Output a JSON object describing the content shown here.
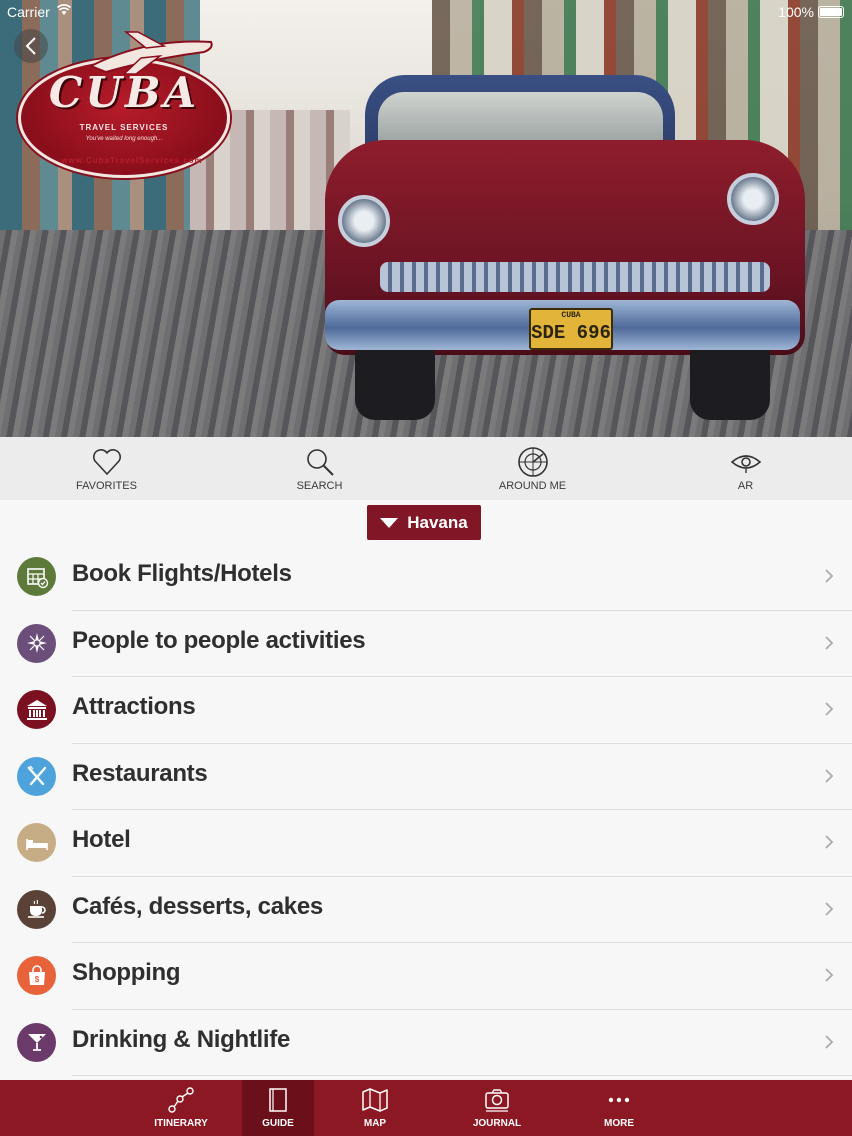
{
  "status_bar": {
    "carrier": "Carrier",
    "battery": "100%"
  },
  "logo": {
    "word": "CUBA",
    "subtitle": "TRAVEL SERVICES",
    "tagline": "You've waited long enough...",
    "url": "www.CubaTravelServices.com",
    "registered": "®"
  },
  "hero": {
    "plate_top": "CUBA",
    "plate": "SDE 696"
  },
  "toolbar": {
    "items": [
      {
        "label": "FAVORITES",
        "icon": "heart-icon"
      },
      {
        "label": "SEARCH",
        "icon": "search-icon"
      },
      {
        "label": "AROUND ME",
        "icon": "radar-icon"
      },
      {
        "label": "AR",
        "icon": "eye-icon"
      }
    ]
  },
  "city_selector": {
    "label": "Havana"
  },
  "list": {
    "items": [
      {
        "label": "Book Flights/Hotels",
        "icon": "booking-icon",
        "color": "#5d7a3a"
      },
      {
        "label": "People to people activities",
        "icon": "compass-icon",
        "color": "#6b4f7a"
      },
      {
        "label": "Attractions",
        "icon": "museum-icon",
        "color": "#7a1020"
      },
      {
        "label": "Restaurants",
        "icon": "cutlery-icon",
        "color": "#4ea3dd"
      },
      {
        "label": "Hotel",
        "icon": "bed-icon",
        "color": "#c6ad85"
      },
      {
        "label": "Cafés, desserts, cakes",
        "icon": "coffee-cup-icon",
        "color": "#5a4336"
      },
      {
        "label": "Shopping",
        "icon": "shopping-bag-icon",
        "color": "#e8623a"
      },
      {
        "label": "Drinking & Nightlife",
        "icon": "cocktail-icon",
        "color": "#6b3a6b"
      }
    ]
  },
  "tabbar": {
    "tabs": [
      {
        "label": "ITINERARY",
        "icon": "itinerary-icon",
        "active": false
      },
      {
        "label": "GUIDE",
        "icon": "book-icon",
        "active": true
      },
      {
        "label": "MAP",
        "icon": "map-icon",
        "active": false
      },
      {
        "label": "JOURNAL",
        "icon": "camera-icon",
        "active": false
      },
      {
        "label": "MORE",
        "icon": "more-icon",
        "active": false
      }
    ]
  },
  "colors": {
    "brand": "#8c1824",
    "brand_dark": "#6b0f1a",
    "selector": "#811626"
  }
}
